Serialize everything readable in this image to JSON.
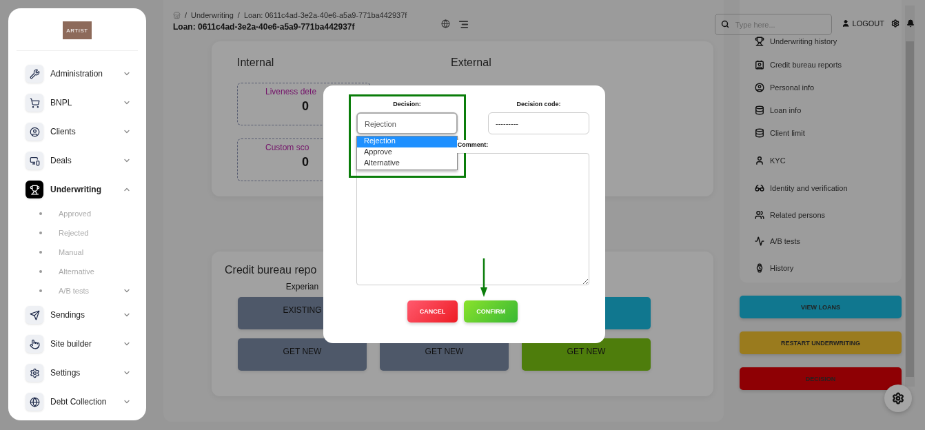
{
  "sidebar": {
    "logo": "ARTIST",
    "items": [
      {
        "label": "Administration",
        "selected": false,
        "expanded": false
      },
      {
        "label": "BNPL",
        "selected": false,
        "expanded": false
      },
      {
        "label": "Clients",
        "selected": false,
        "expanded": false
      },
      {
        "label": "Deals",
        "selected": false,
        "expanded": false
      },
      {
        "label": "Underwriting",
        "selected": true,
        "expanded": true,
        "children": [
          {
            "label": "Approved",
            "expandable": false
          },
          {
            "label": "Rejected",
            "expandable": false
          },
          {
            "label": "Manual",
            "expandable": false
          },
          {
            "label": "Alternative",
            "expandable": false
          },
          {
            "label": "A/B tests",
            "expandable": true
          }
        ]
      },
      {
        "label": "Sendings",
        "selected": false,
        "expanded": false
      },
      {
        "label": "Site builder",
        "selected": false,
        "expanded": false
      },
      {
        "label": "Settings",
        "selected": false,
        "expanded": false
      },
      {
        "label": "Debt Collection",
        "selected": false,
        "expanded": false
      }
    ]
  },
  "header": {
    "breadcrumb": [
      "/",
      "Underwriting",
      "/",
      "Loan: 0611c4ad-3e2a-40e6-a5a9-771ba442937f"
    ],
    "title": "Loan: 0611c4ad-3e2a-40e6-a5a9-771ba442937f",
    "search": {
      "placeholder": "Type here..."
    },
    "logout": "LOGOUT"
  },
  "scores": {
    "columns": [
      {
        "title": "Internal",
        "cards": [
          {
            "label": "Liveness dete",
            "value": "0"
          },
          {
            "label": "Custom sco",
            "value": "0"
          }
        ]
      },
      {
        "title": "External"
      }
    ]
  },
  "credit_bureau": {
    "title": "Credit bureau repo",
    "providers": [
      "Experian"
    ],
    "rows": [
      [
        {
          "label": "EXISTING",
          "color": "#4e5869"
        },
        {
          "color": "#10778f"
        }
      ],
      [
        {
          "label": "GET NEW",
          "color": "#4e5869"
        },
        {
          "label": "GET NEW",
          "color": "#4e5869"
        },
        {
          "label": "GET NEW",
          "color": "#4e7d0c"
        }
      ]
    ]
  },
  "right_menu": {
    "items": [
      "Underwriting history",
      "Credit bureau reports",
      "Personal info",
      "Loan info",
      "Client limit",
      "KYC",
      "Identity and verification",
      "Related persons",
      "A/B tests",
      "History"
    ],
    "actions": [
      {
        "label": "VIEW LOANS",
        "color": "#10778f"
      },
      {
        "label": "RESTART UNDERWRITING",
        "color": "#9a7b1e"
      },
      {
        "label": "DECISION",
        "color": "#8e0004"
      }
    ]
  },
  "modal": {
    "decision_label": "Decision:",
    "decision_value": "Rejection",
    "options": [
      {
        "label": "Rejection",
        "selected": true
      },
      {
        "label": "Approve",
        "selected": false
      },
      {
        "label": "Alternative",
        "selected": false
      }
    ],
    "code_label": "Decision code:",
    "code_value": "---------",
    "comment_label": "Comment:",
    "cancel": "CANCEL",
    "confirm": "CONFIRM"
  }
}
